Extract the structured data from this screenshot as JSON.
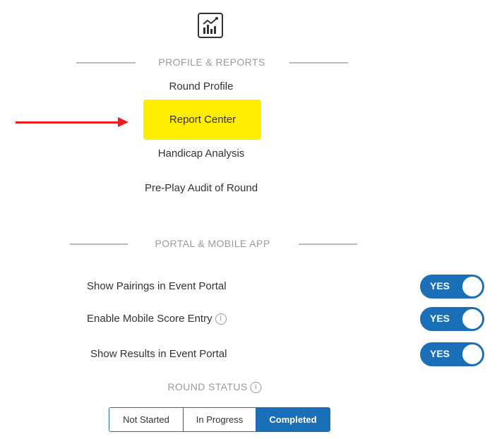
{
  "icons": {
    "report": "bar-chart-report-icon",
    "info": "info-icon"
  },
  "profile_reports": {
    "heading": "PROFILE & REPORTS",
    "items": [
      {
        "label": "Round Profile"
      },
      {
        "label": "Report Center",
        "highlighted": true
      },
      {
        "label": "Handicap Analysis"
      },
      {
        "label": "Pre-Play Audit of Round"
      }
    ]
  },
  "portal_mobile": {
    "heading": "PORTAL & MOBILE APP",
    "settings": [
      {
        "label": "Show Pairings in Event Portal",
        "value": "YES"
      },
      {
        "label": "Enable Mobile Score Entry",
        "value": "YES",
        "has_info": true
      },
      {
        "label": "Show Results in Event Portal",
        "value": "YES"
      }
    ]
  },
  "round_status": {
    "heading": "ROUND STATUS",
    "options": [
      "Not Started",
      "In Progress",
      "Completed"
    ],
    "selected": "Completed"
  },
  "annotation": {
    "arrow_color": "#ee1c1c",
    "highlight_color": "#ffee00"
  },
  "colors": {
    "accent": "#1a6fb6",
    "divider": "#b9b9b9",
    "muted_text": "#9a9a9a"
  }
}
